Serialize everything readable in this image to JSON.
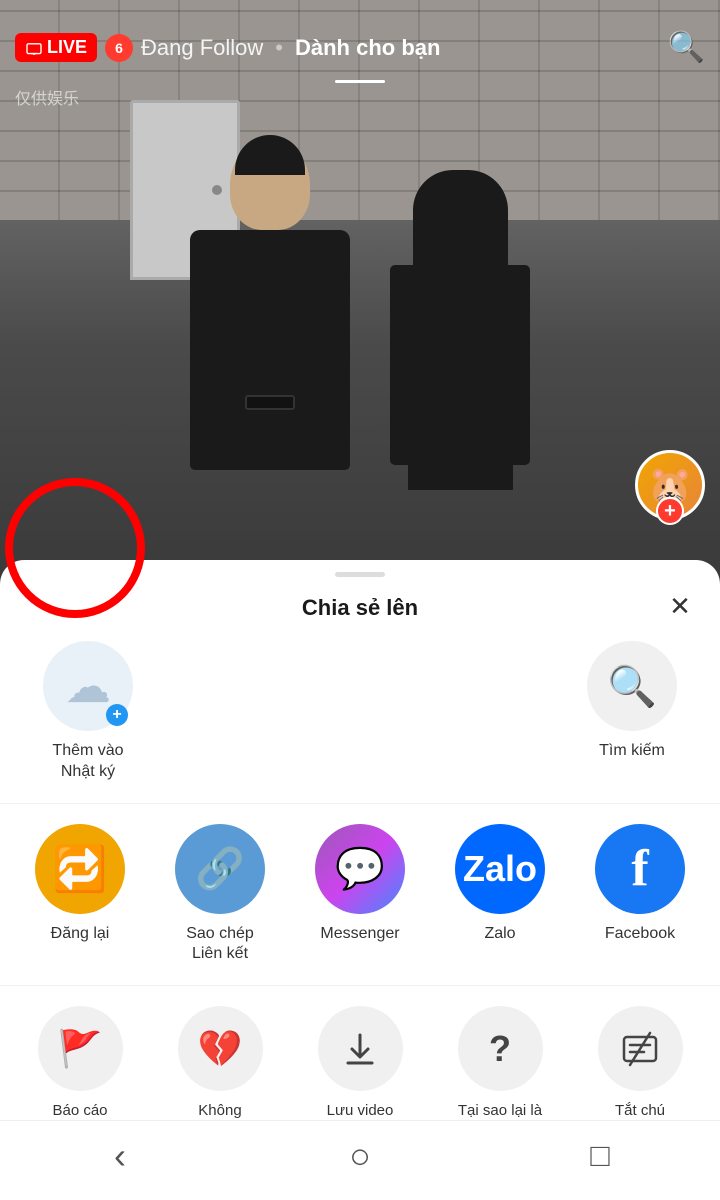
{
  "header": {
    "live_label": "LIVE",
    "notification_count": "6",
    "following_tab": "Đang Follow",
    "for_you_tab": "Dành cho bạn",
    "search_icon": "🔍",
    "watermark": "仅供娱乐"
  },
  "avatar": {
    "emoji": "🐹",
    "plus": "+"
  },
  "bottom_sheet": {
    "title": "Chia sẻ lên",
    "close": "✕",
    "first_row": [
      {
        "id": "add-diary",
        "label": "Thêm vào\nNhật ký",
        "icon": "☁"
      },
      {
        "id": "search",
        "label": "Tìm kiếm",
        "icon": "🔍"
      }
    ],
    "apps": [
      {
        "id": "dangLai",
        "label": "Đăng lại",
        "icon": "🔁",
        "bg": "#f0a500"
      },
      {
        "id": "saoChep",
        "label": "Sao chép\nLiên kết",
        "icon": "🔗",
        "bg": "#5b9bd5"
      },
      {
        "id": "messenger",
        "label": "Messenger",
        "icon": "💬",
        "bg": "#cc44cc"
      },
      {
        "id": "zalo",
        "label": "Zalo",
        "icon": "Z",
        "bg": "#0068ff"
      },
      {
        "id": "facebook",
        "label": "Facebook",
        "icon": "f",
        "bg": "#1877f2"
      }
    ],
    "actions": [
      {
        "id": "baoCao",
        "label": "Báo cáo",
        "icon": "🚩"
      },
      {
        "id": "khongQuanTam",
        "label": "Không\nquan tâm",
        "icon": "💔"
      },
      {
        "id": "luuVideo",
        "label": "Lưu video",
        "icon": "⬇"
      },
      {
        "id": "taiSao",
        "label": "Tại sao lại là\nvideo này",
        "icon": "?"
      },
      {
        "id": "tatChuThich",
        "label": "Tắt chú\nthích",
        "icon": "⊠"
      }
    ]
  },
  "nav": {
    "back": "‹",
    "home": "○",
    "recent": "□"
  }
}
